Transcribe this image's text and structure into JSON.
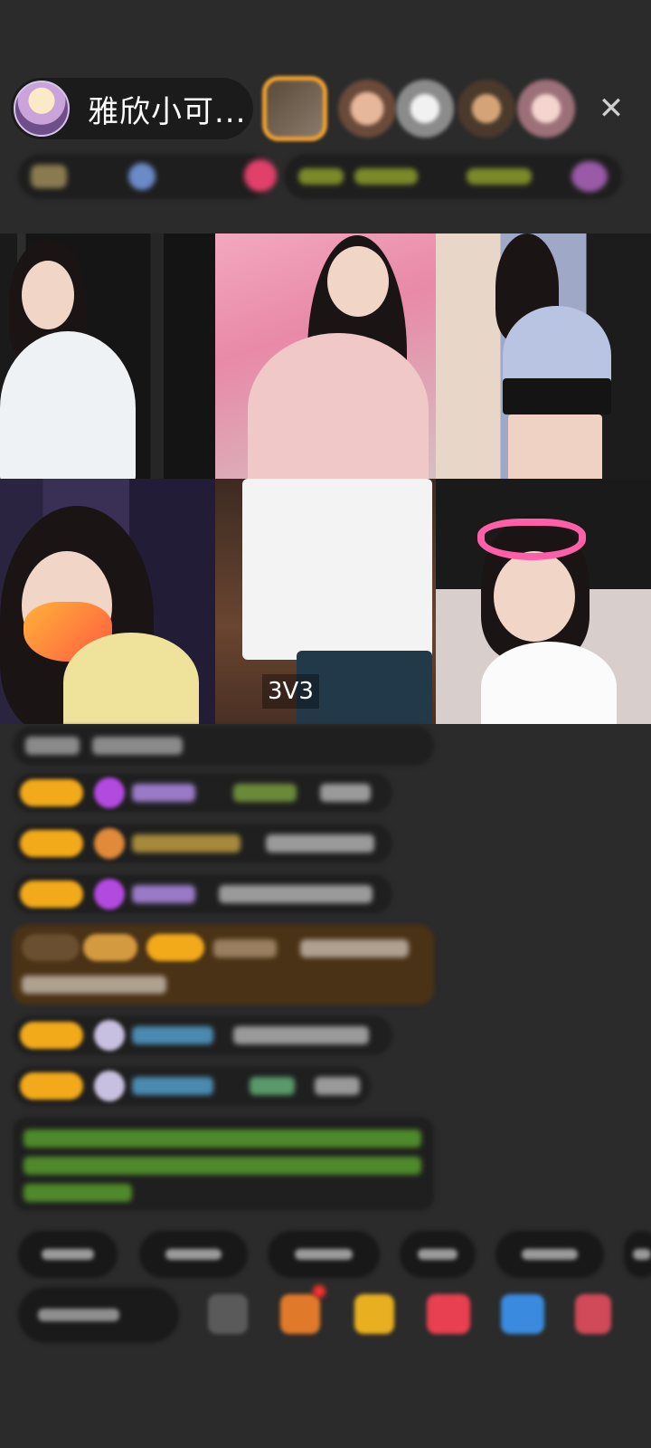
{
  "header": {
    "host_name": "雅欣小可...",
    "close_icon": "close-icon"
  },
  "grid": {
    "tiles": 6,
    "overlay_label": "3V3"
  },
  "colors": {
    "background": "#2b2b2b",
    "level_badge": "#f2a91a",
    "green_notice": "#6fbf3a",
    "highlight_bar": "#4a3216"
  }
}
